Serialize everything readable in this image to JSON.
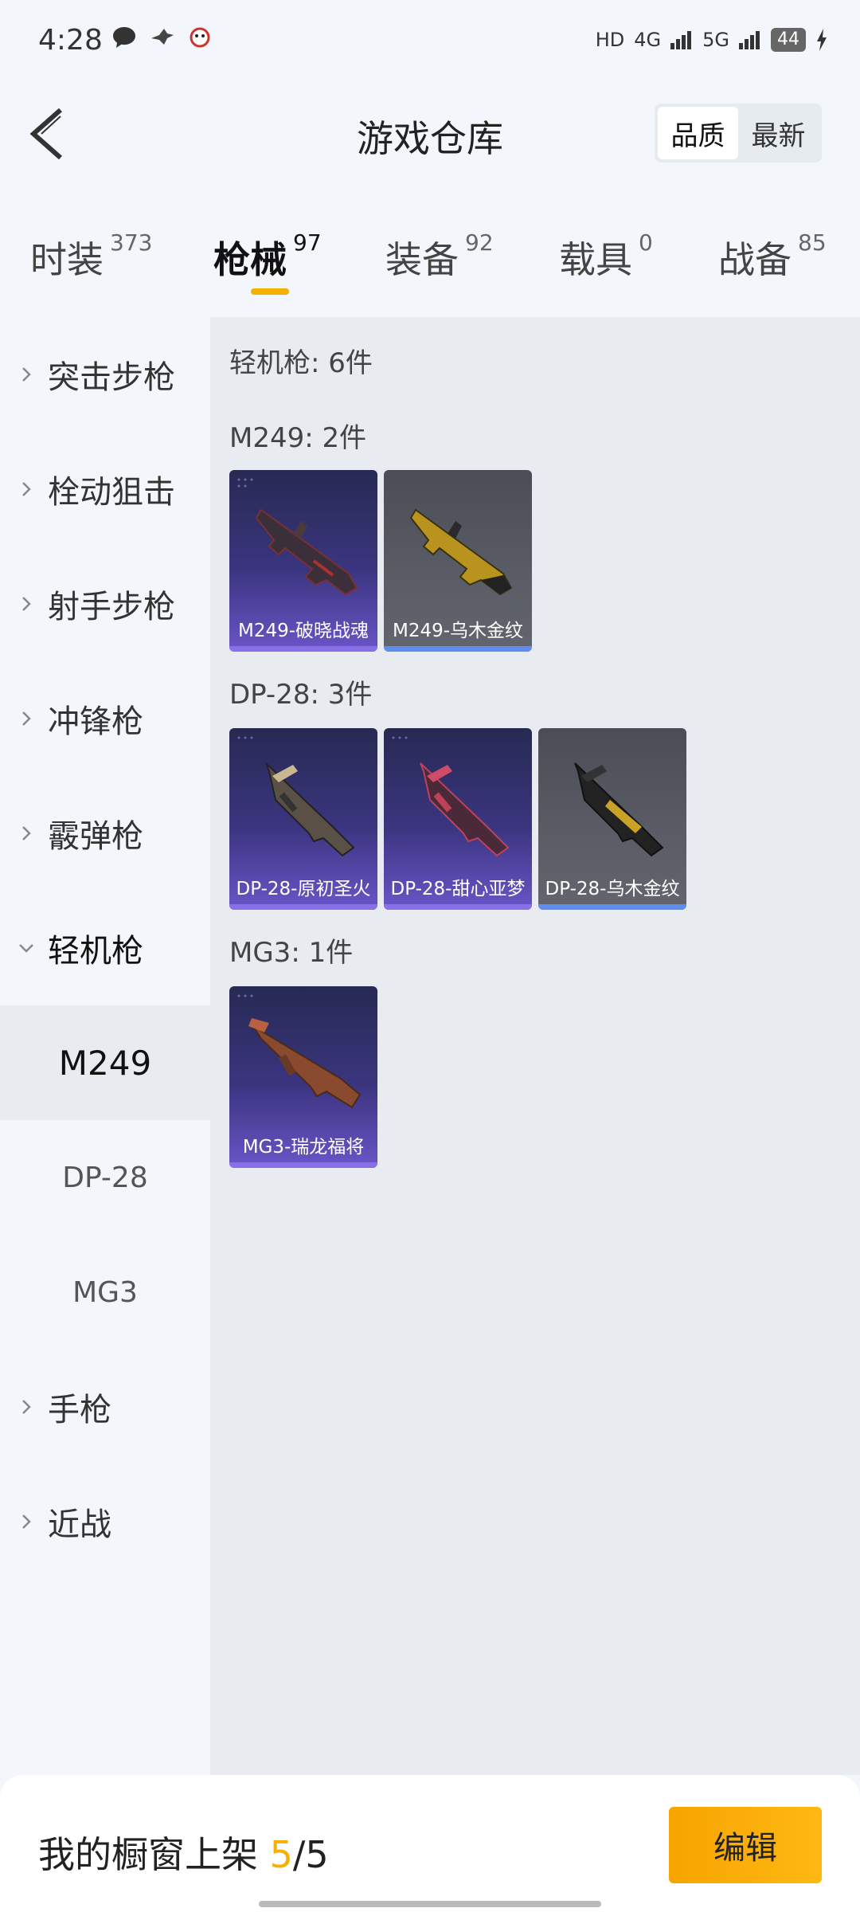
{
  "status_bar": {
    "time": "4:28",
    "left_icons": [
      "chat-bubble-icon",
      "bird-icon",
      "game-mascot-icon"
    ],
    "network": [
      "HD",
      "4G",
      "5G"
    ],
    "battery": "44"
  },
  "header": {
    "title": "游戏仓库",
    "sort_options": [
      {
        "label": "品质",
        "active": true
      },
      {
        "label": "最新",
        "active": false
      }
    ]
  },
  "tabs": [
    {
      "label": "时装",
      "count": "373",
      "active": false
    },
    {
      "label": "枪械",
      "count": "97",
      "active": true
    },
    {
      "label": "装备",
      "count": "92",
      "active": false
    },
    {
      "label": "载具",
      "count": "0",
      "active": false
    },
    {
      "label": "战备",
      "count": "85",
      "active": false
    }
  ],
  "sidebar": {
    "categories": [
      {
        "label": "突击步枪",
        "expanded": false
      },
      {
        "label": "栓动狙击",
        "expanded": false
      },
      {
        "label": "射手步枪",
        "expanded": false
      },
      {
        "label": "冲锋枪",
        "expanded": false
      },
      {
        "label": "霰弹枪",
        "expanded": false
      },
      {
        "label": "轻机枪",
        "expanded": true
      },
      {
        "label": "手枪",
        "expanded": false
      },
      {
        "label": "近战",
        "expanded": false
      }
    ],
    "subitems": [
      {
        "label": "M249",
        "active": true
      },
      {
        "label": "DP-28",
        "active": false
      },
      {
        "label": "MG3",
        "active": false
      }
    ]
  },
  "content": {
    "total": "轻机枪: 6件",
    "groups": [
      {
        "title": "M249: 2件",
        "items": [
          {
            "name": "M249-破晓战魂",
            "tier": "purple"
          },
          {
            "name": "M249-乌木金纹",
            "tier": "gray"
          }
        ]
      },
      {
        "title": "DP-28: 3件",
        "items": [
          {
            "name": "DP-28-原初圣火",
            "tier": "purple"
          },
          {
            "name": "DP-28-甜心亚梦",
            "tier": "purple"
          },
          {
            "name": "DP-28-乌木金纹",
            "tier": "gray"
          }
        ]
      },
      {
        "title": "MG3: 1件",
        "items": [
          {
            "name": "MG3-瑞龙福将",
            "tier": "purple"
          }
        ]
      }
    ]
  },
  "bottom_bar": {
    "label": "我的橱窗上架",
    "current": "5",
    "separator": "/",
    "total": "5",
    "edit_label": "编辑"
  },
  "colors": {
    "accent": "#f5b000",
    "purple_tier": "#6a55c8",
    "gray_tier": "#5e8ff0"
  }
}
